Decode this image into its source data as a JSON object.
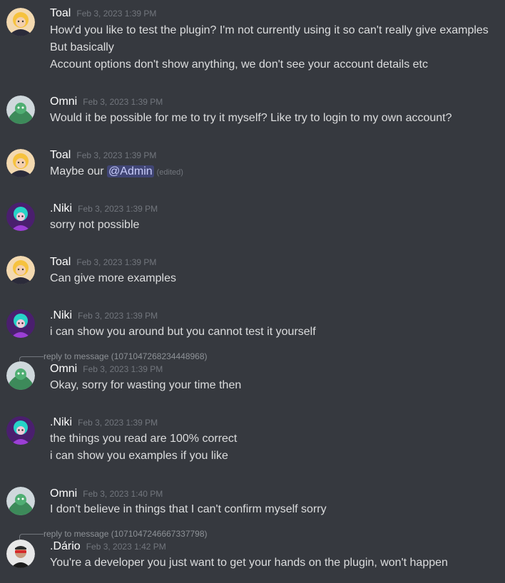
{
  "messages": [
    {
      "author": "Toal",
      "avatar": "toal-avatar",
      "time": "Feb 3, 2023 1:39 PM",
      "lines": [
        "How'd you like to test the plugin? I'm not currently using it so can't really give examples",
        "But basically",
        "Account options don't show anything, we don't see your account details etc"
      ]
    },
    {
      "author": "Omni",
      "avatar": "omni-avatar",
      "time": "Feb 3, 2023 1:39 PM",
      "lines": [
        "Would it be possible for me to try it myself? Like try to login to my own account?"
      ]
    },
    {
      "author": "Toal",
      "avatar": "toal-avatar",
      "time": "Feb 3, 2023 1:39 PM",
      "prefix": "Maybe our ",
      "mention": "@Admin",
      "edited": "(edited)"
    },
    {
      "author": ".Niki",
      "avatar": "niki-avatar",
      "time": "Feb 3, 2023 1:39 PM",
      "lines": [
        "sorry not possible"
      ]
    },
    {
      "author": "Toal",
      "avatar": "toal-avatar",
      "time": "Feb 3, 2023 1:39 PM",
      "lines": [
        "Can give more examples"
      ]
    },
    {
      "author": ".Niki",
      "avatar": "niki-avatar",
      "time": "Feb 3, 2023 1:39 PM",
      "lines": [
        "i can show you around but you cannot test it yourself"
      ]
    },
    {
      "author": "Omni",
      "avatar": "omni-avatar",
      "time": "Feb 3, 2023 1:39 PM",
      "reply": "reply to message (1071047268234448968)",
      "lines": [
        "Okay, sorry for wasting your time then"
      ]
    },
    {
      "author": ".Niki",
      "avatar": "niki-avatar",
      "time": "Feb 3, 2023 1:39 PM",
      "lines": [
        "the things you read are 100% correct",
        "i can show you examples if you like"
      ]
    },
    {
      "author": "Omni",
      "avatar": "omni-avatar",
      "time": "Feb 3, 2023 1:40 PM",
      "lines": [
        "I don't believe in things that I can't confirm myself sorry"
      ]
    },
    {
      "author": ".Dário",
      "avatar": "dario-avatar",
      "time": "Feb 3, 2023 1:42 PM",
      "reply": "reply to message (1071047246667337798)",
      "lines": [
        "You're a developer you just want to get your hands on the plugin, won't happen"
      ]
    }
  ]
}
